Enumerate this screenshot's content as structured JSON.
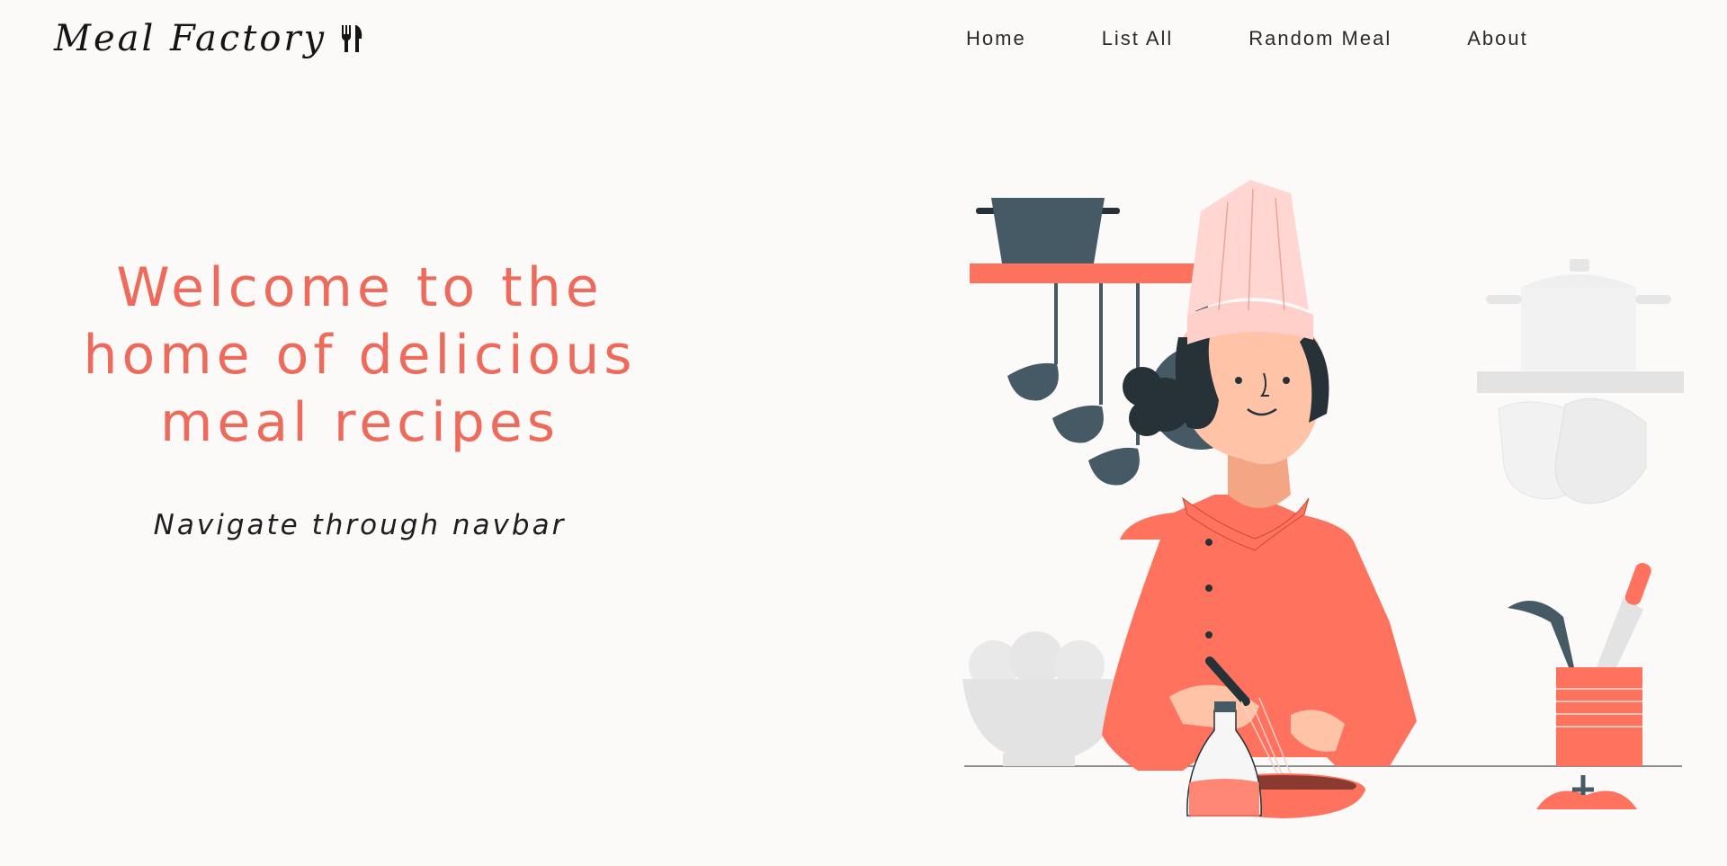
{
  "brand": {
    "name": "Meal Factory",
    "icon": "fork-knife-icon"
  },
  "nav": {
    "items": [
      {
        "label": "Home"
      },
      {
        "label": "List All"
      },
      {
        "label": "Random Meal"
      },
      {
        "label": "About"
      }
    ]
  },
  "hero": {
    "title_line1": "Welcome to the",
    "title_line2": "home of delicious",
    "title_line3": "meal recipes",
    "subtitle": "Navigate through navbar"
  },
  "colors": {
    "accent": "#ee6a5a",
    "coral": "#ff725e",
    "dark_slate": "#455a64",
    "background": "#fcf9f9"
  }
}
